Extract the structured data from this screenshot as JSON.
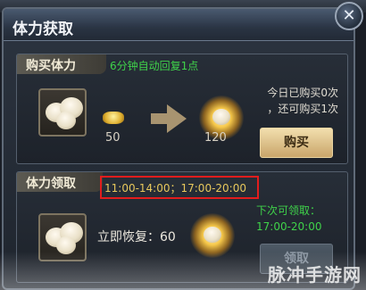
{
  "panel": {
    "title": "体力获取",
    "close_icon": "close-icon"
  },
  "buy_section": {
    "header": "购买体力",
    "note": "6分钟自动回复1点",
    "cost": "50",
    "gain": "120",
    "status_line1": "今日已购买0次",
    "status_line2": "，还可购买1次",
    "button_label": "购买"
  },
  "claim_section": {
    "header": "体力领取",
    "time_windows": "11:00-14:00；17:00-20:00",
    "recover_label": "立即恢复：60",
    "next_label": "下次可领取：",
    "next_time": "17:00-20:00",
    "button_label": "领取"
  },
  "watermark": "脉冲手游网",
  "colors": {
    "accent_green": "#3fd24a",
    "highlight_red": "#e21d1d",
    "button_gold": "#d9bd84"
  }
}
